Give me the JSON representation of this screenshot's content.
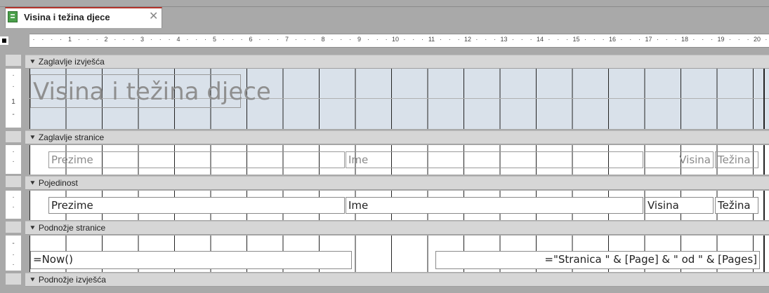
{
  "tab": {
    "title": "Visina i težina djece",
    "icon": "report-icon",
    "close": "✕"
  },
  "ruler": {
    "ticks": [
      "1",
      "2",
      "3",
      "4",
      "5",
      "6",
      "7",
      "8",
      "9",
      "10",
      "11",
      "12",
      "13",
      "14",
      "15",
      "16",
      "17",
      "18",
      "19",
      "20"
    ]
  },
  "vertical_ruler": {
    "mark": "1"
  },
  "sections": {
    "report_header": {
      "label": "Zaglavlje izvješća",
      "title": "Visina i težina djece",
      "background": "#d9e1ea"
    },
    "page_header": {
      "label": "Zaglavlje stranice",
      "col1": "Prezime",
      "col2": "Ime",
      "col3": "Visina",
      "col4": "Težina"
    },
    "detail": {
      "label": "Pojedinost",
      "field1": "Prezime",
      "field2": "Ime",
      "field3": "Visina",
      "field4": "Težina"
    },
    "page_footer": {
      "label": "Podnožje stranice",
      "date": "=Now()",
      "page": "=\"Stranica \" & [Page] & \" od \" & [Pages]"
    },
    "report_footer": {
      "label": "Podnožje izvješća"
    }
  },
  "colors": {
    "accent": "#b3332b",
    "section_bar": "#d6d6d6",
    "header_fill": "#d9e1ea",
    "workspace": "#a9a9a9"
  }
}
